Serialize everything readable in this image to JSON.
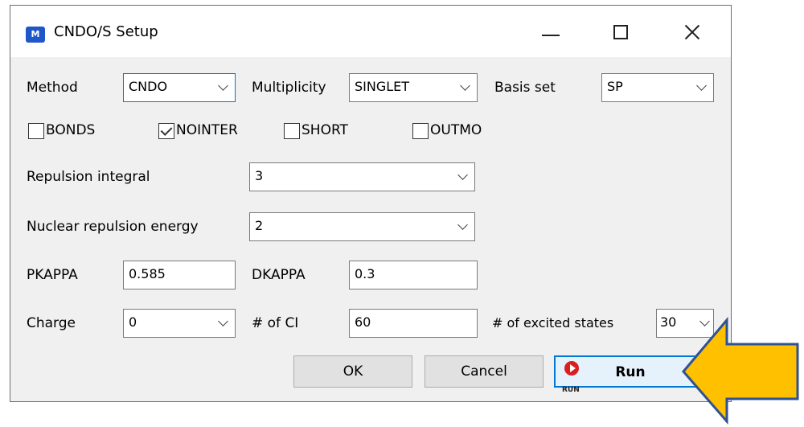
{
  "window": {
    "title": "CNDO/S Setup",
    "app_icon_text": "M"
  },
  "row1": {
    "method_label": "Method",
    "method_value": "CNDO",
    "multiplicity_label": "Multiplicity",
    "multiplicity_value": "SINGLET",
    "basis_label": "Basis set",
    "basis_value": "SP"
  },
  "options": [
    {
      "label": "BONDS",
      "checked": false
    },
    {
      "label": "NOINTER",
      "checked": true
    },
    {
      "label": "SHORT",
      "checked": false
    },
    {
      "label": "OUTMO",
      "checked": false
    }
  ],
  "repulsion": {
    "label": "Repulsion integral",
    "value": "3"
  },
  "nuclear": {
    "label": "Nuclear repulsion energy",
    "value": "2"
  },
  "kappa": {
    "pkappa_label": "PKAPPA",
    "pkappa_value": "0.585",
    "dkappa_label": "DKAPPA",
    "dkappa_value": "0.3"
  },
  "charge_row": {
    "charge_label": "Charge",
    "charge_value": "0",
    "ci_label": "# of CI",
    "ci_value": "60",
    "excited_label": "# of excited states",
    "excited_value": "30"
  },
  "buttons": {
    "ok": "OK",
    "cancel": "Cancel",
    "run": "Run",
    "run_icon_tag": "RUN"
  },
  "colors": {
    "accent": "#0078d7",
    "arrow_fill": "#ffc000",
    "arrow_stroke": "#2f528f"
  }
}
